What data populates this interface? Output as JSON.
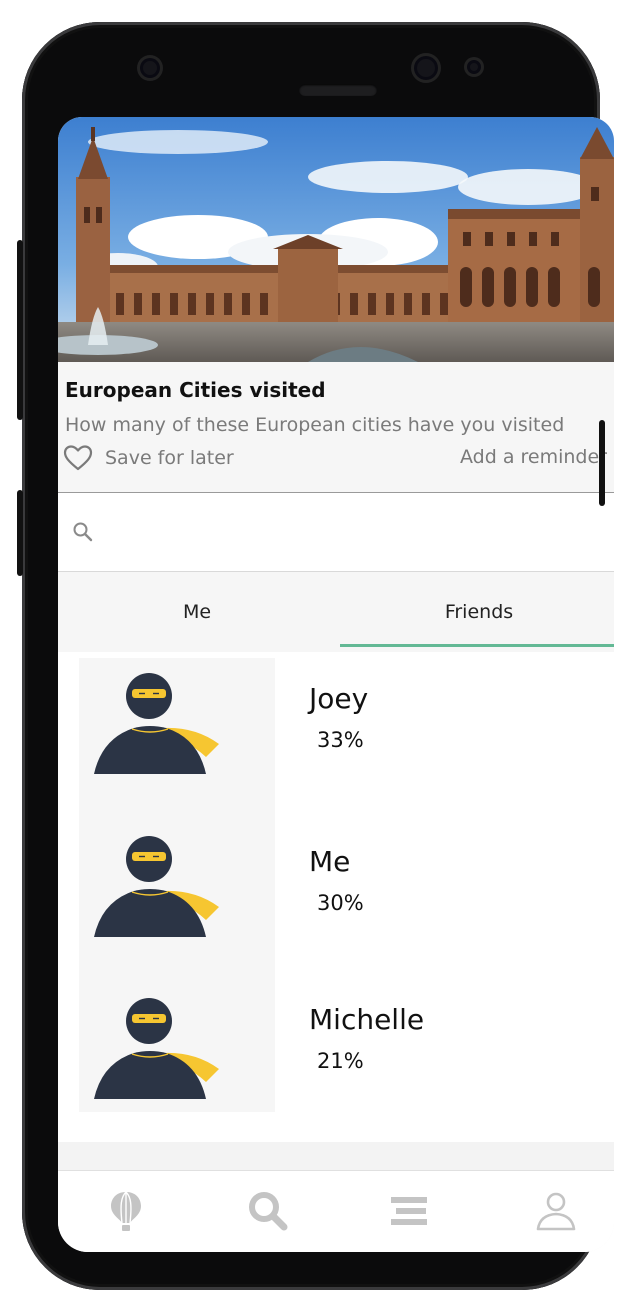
{
  "card": {
    "title": "European Cities visited",
    "subtitle": "How many of these European cities have you visited",
    "save_label": "Save for later",
    "reminder_label": "Add a reminder"
  },
  "search": {
    "placeholder": "",
    "value": ""
  },
  "tabs": [
    {
      "label": "Me",
      "active": false
    },
    {
      "label": "Friends",
      "active": true
    }
  ],
  "friends": [
    {
      "name": "Joey",
      "percent": "33%"
    },
    {
      "name": "Me",
      "percent": "30%"
    },
    {
      "name": "Michelle",
      "percent": "21%"
    }
  ],
  "bottom_nav": [
    {
      "icon": "hot-air-balloon-icon"
    },
    {
      "icon": "search-icon"
    },
    {
      "icon": "list-icon"
    },
    {
      "icon": "profile-icon"
    }
  ],
  "colors": {
    "accent": "#63b995",
    "avatar_body": "#2b3445",
    "avatar_mask": "#f6c631",
    "nav_icon": "#c4c4c4",
    "secondary_text": "#7a7a7a"
  }
}
